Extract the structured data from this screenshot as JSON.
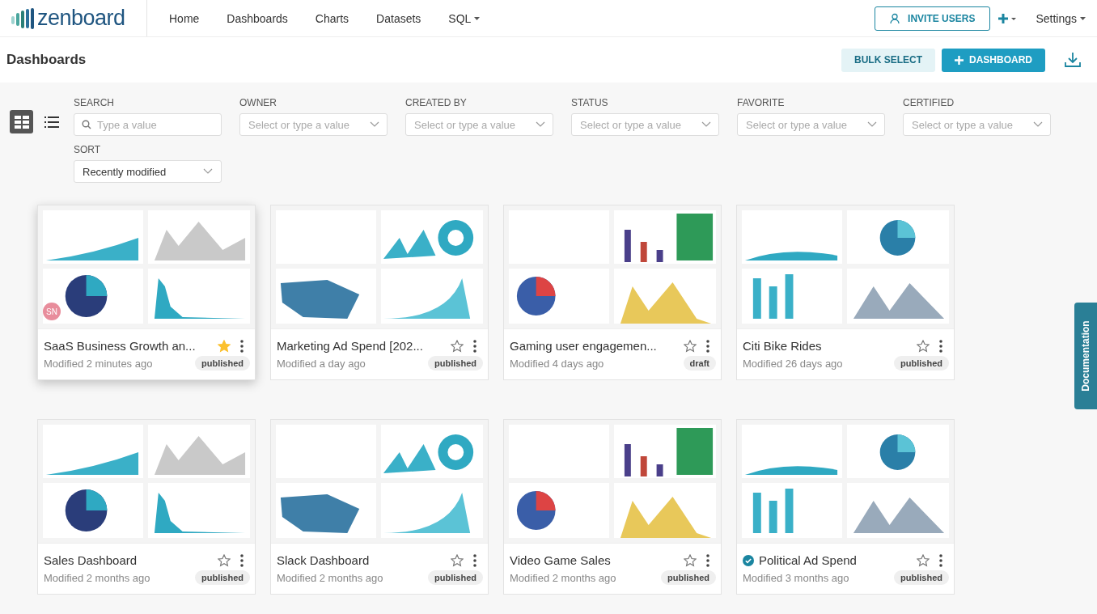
{
  "brand": "zenboard",
  "nav": [
    {
      "label": "Home",
      "dropdown": false
    },
    {
      "label": "Dashboards",
      "dropdown": false
    },
    {
      "label": "Charts",
      "dropdown": false
    },
    {
      "label": "Datasets",
      "dropdown": false
    },
    {
      "label": "SQL",
      "dropdown": true
    }
  ],
  "header_right": {
    "invite": "INVITE USERS",
    "settings": "Settings"
  },
  "page": {
    "title": "Dashboards",
    "bulk_select": "BULK SELECT",
    "add": "DASHBOARD"
  },
  "view_toggle": [
    {
      "kind": "grid",
      "selected": true
    },
    {
      "kind": "list",
      "selected": false
    }
  ],
  "filters": [
    {
      "label": "SEARCH",
      "kind": "search",
      "placeholder": "Type a value"
    },
    {
      "label": "OWNER",
      "kind": "select",
      "placeholder": "Select or type a value"
    },
    {
      "label": "CREATED BY",
      "kind": "select",
      "placeholder": "Select or type a value"
    },
    {
      "label": "STATUS",
      "kind": "select",
      "placeholder": "Select or type a value"
    },
    {
      "label": "FAVORITE",
      "kind": "select",
      "placeholder": "Select or type a value"
    },
    {
      "label": "CERTIFIED",
      "kind": "select",
      "placeholder": "Select or type a value"
    }
  ],
  "sort": {
    "label": "SORT",
    "value": "Recently modified"
  },
  "cards": [
    {
      "title": "SaaS Business Growth an...",
      "modified": "Modified 2 minutes ago",
      "status": "published",
      "favorite": true,
      "certified": false,
      "hovered": true,
      "avatar": "SN"
    },
    {
      "title": "Marketing Ad Spend [202...",
      "modified": "Modified a day ago",
      "status": "published",
      "favorite": false,
      "certified": false,
      "hovered": false
    },
    {
      "title": "Gaming user engagemen...",
      "modified": "Modified 4 days ago",
      "status": "draft",
      "favorite": false,
      "certified": false,
      "hovered": false
    },
    {
      "title": "Citi Bike Rides",
      "modified": "Modified 26 days ago",
      "status": "published",
      "favorite": false,
      "certified": false,
      "hovered": false
    },
    {
      "title": "Sales Dashboard",
      "modified": "Modified 2 months ago",
      "status": "published",
      "favorite": false,
      "certified": false,
      "hovered": false
    },
    {
      "title": "Slack Dashboard",
      "modified": "Modified 2 months ago",
      "status": "published",
      "favorite": false,
      "certified": false,
      "hovered": false
    },
    {
      "title": "Video Game Sales",
      "modified": "Modified 2 months ago",
      "status": "published",
      "favorite": false,
      "certified": false,
      "hovered": false
    },
    {
      "title": "Political Ad Spend",
      "modified": "Modified 3 months ago",
      "status": "published",
      "favorite": false,
      "certified": true,
      "hovered": false
    }
  ],
  "side_tab": "Documentation"
}
